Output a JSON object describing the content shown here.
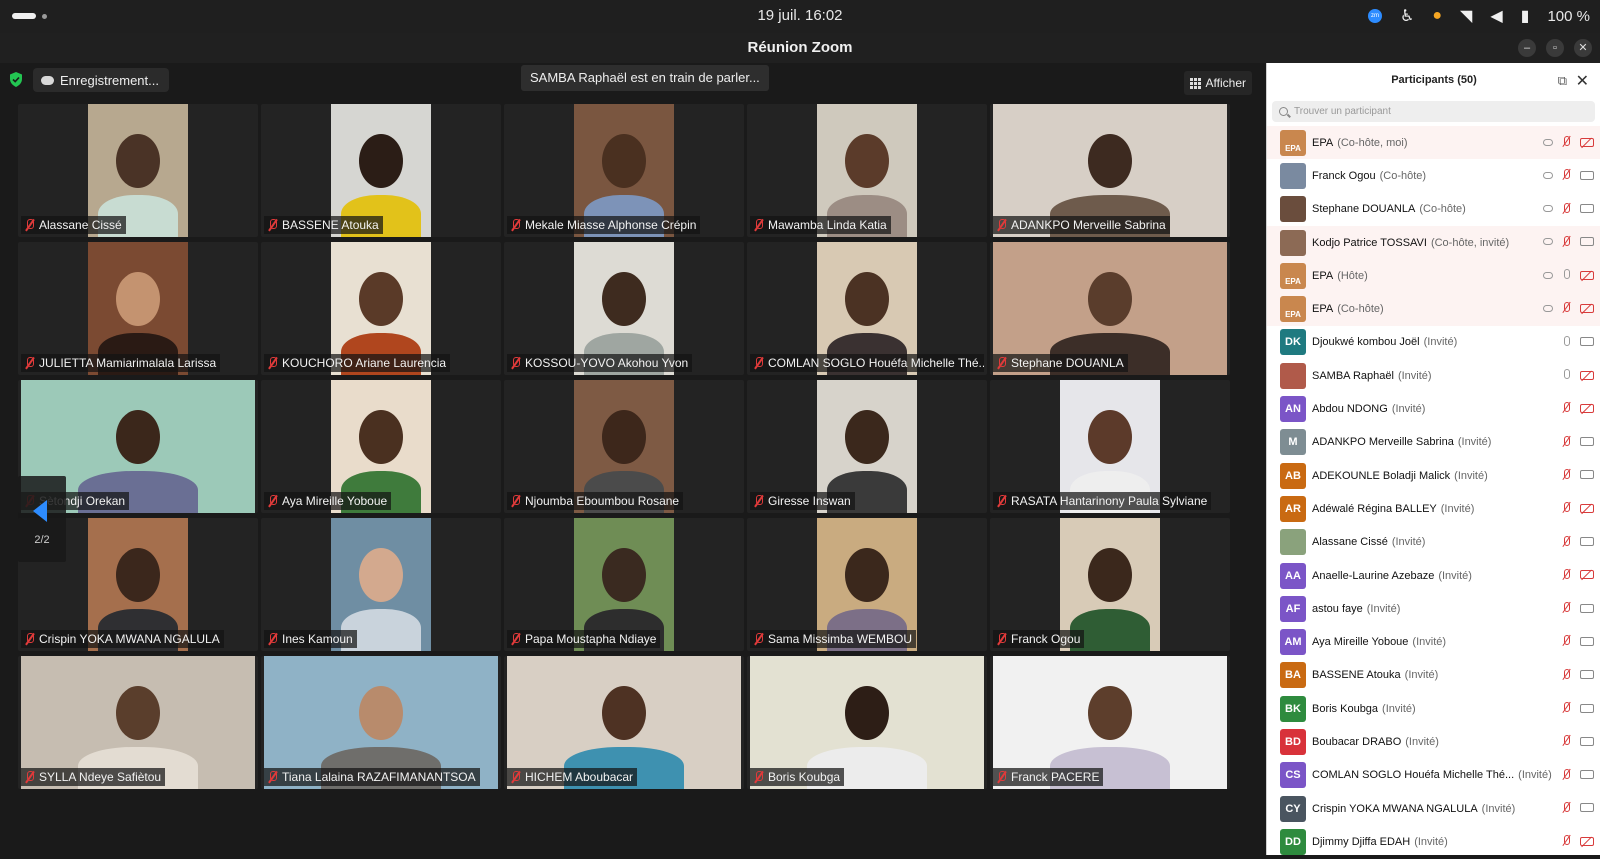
{
  "system": {
    "clock": "19 juil.   16:02",
    "zoom_badge": "zm",
    "battery": "100 %"
  },
  "window": {
    "title": "Réunion Zoom"
  },
  "meeting": {
    "recording_label": "Enregistrement...",
    "speaking_banner": "SAMBA Raphaël est en train de parler...",
    "view_label": "Afficher",
    "page_indicator": "2/2"
  },
  "tiles": [
    {
      "name": "Alassane Cissé",
      "bg": "#b7a88f",
      "skin": "#4a3326",
      "shirt": "#c8dcd2"
    },
    {
      "name": "BASSENE Atouka",
      "bg": "#d6d6d2",
      "skin": "#2b1d16",
      "shirt": "#e2c21a"
    },
    {
      "name": "Mekale Miasse Alphonse Crépin",
      "bg": "#7a5640",
      "skin": "#4a3020",
      "shirt": "#7d93b8"
    },
    {
      "name": "Mawamba Linda Katia",
      "bg": "#cfc9bd",
      "skin": "#5b3b2a",
      "shirt": "#9c8d84"
    },
    {
      "name": "ADANKPO Merveille Sabrina",
      "bg": "#d7cfc6",
      "skin": "#3d2a20",
      "shirt": "#6e5b4c"
    },
    {
      "name": "JULIETTA Mamiarimalala Larissa",
      "bg": "#7b4a32",
      "skin": "#c49370",
      "shirt": "#2a1a14"
    },
    {
      "name": "KOUCHORO Ariane Laurencia",
      "bg": "#e8e0d2",
      "skin": "#5a3a28",
      "shirt": "#b0461e"
    },
    {
      "name": "KOSSOU-YOVO Akohou Yvon",
      "bg": "#dddbd4",
      "skin": "#3e2b1f",
      "shirt": "#9fa6a1"
    },
    {
      "name": "COMLAN SOGLO Houéfa Michelle Thé...",
      "bg": "#d8c9b3",
      "skin": "#4b3223",
      "shirt": "#3a3131"
    },
    {
      "name": "Stephane DOUANLA",
      "bg": "#c3a089",
      "skin": "#5a3d2c",
      "shirt": "#3c2e28"
    },
    {
      "name": "Sètondji Orekan",
      "bg": "#9cc9b8",
      "skin": "#3b271b",
      "shirt": "#6a6f94"
    },
    {
      "name": "Aya Mireille Yoboue",
      "bg": "#e9dccb",
      "skin": "#4a3020",
      "shirt": "#3f7b3c"
    },
    {
      "name": "Njoumba Eboumbou Rosane",
      "bg": "#7e5a44",
      "skin": "#3d271b",
      "shirt": "#4b4b4b"
    },
    {
      "name": "Giresse Inswan",
      "bg": "#d7d3cb",
      "skin": "#3b281c",
      "shirt": "#3a3a3a"
    },
    {
      "name": "RASATA Hantarinony Paula Sylviane",
      "bg": "#e6e6ea",
      "skin": "#5c3a2a",
      "shirt": "#eeeeee"
    },
    {
      "name": "Crispin YOKA MWANA NGALULA",
      "bg": "#a56f4d",
      "skin": "#3b271c",
      "shirt": "#2f2f32"
    },
    {
      "name": "Ines Kamoun",
      "bg": "#6f8ea3",
      "skin": "#d3a98e",
      "shirt": "#c9d3dc"
    },
    {
      "name": "Papa Moustapha Ndiaye",
      "bg": "#6f8d55",
      "skin": "#3a2a20",
      "shirt": "#2d2d2d"
    },
    {
      "name": "Sama Missimba WEMBOU",
      "bg": "#c9ab80",
      "skin": "#3b281c",
      "shirt": "#7c6f87"
    },
    {
      "name": "Franck Ogou",
      "bg": "#d8cbb7",
      "skin": "#3b281c",
      "shirt": "#2f5d34"
    },
    {
      "name": "SYLLA Ndeye Safiètou",
      "bg": "#c6bdb1",
      "skin": "#5a3e2c",
      "shirt": "#e3dcd2"
    },
    {
      "name": "Tiana Lalaina RAZAFIMANANTSOA",
      "bg": "#8fb2c6",
      "skin": "#b88b6c",
      "shirt": "#6f6e6b"
    },
    {
      "name": "HICHEM Aboubacar",
      "bg": "#d8cfc4",
      "skin": "#4e3223",
      "shirt": "#3e91b0"
    },
    {
      "name": "Boris Koubga",
      "bg": "#e3e1d2",
      "skin": "#2d1e16",
      "shirt": "#ececec"
    },
    {
      "name": "Franck PACERE",
      "bg": "#f1f1f1",
      "skin": "#5d3e2c",
      "shirt": "#c7c0d3"
    }
  ],
  "participants_panel": {
    "title": "Participants (50)",
    "search_placeholder": "Trouver un participant",
    "list": [
      {
        "initials": "EPA",
        "name": "EPA",
        "role": "(Co-hôte, moi)",
        "color": "#c9874e",
        "host": true,
        "cloud": true,
        "mic_on": false,
        "cam_off": true
      },
      {
        "initials": "",
        "name": "Franck Ogou",
        "role": "(Co-hôte)",
        "color": "#7a8aa0",
        "host": false,
        "cloud": true,
        "mic_on": false,
        "cam_off": false
      },
      {
        "initials": "",
        "name": "Stephane DOUANLA",
        "role": "(Co-hôte)",
        "color": "#6a4d3d",
        "host": false,
        "cloud": true,
        "mic_on": false,
        "cam_off": false
      },
      {
        "initials": "",
        "name": "Kodjo Patrice TOSSAVI",
        "role": "(Co-hôte, invité)",
        "color": "#8c6a55",
        "host": true,
        "cloud": true,
        "mic_on": false,
        "cam_off": false
      },
      {
        "initials": "EPA",
        "name": "EPA",
        "role": "(Hôte)",
        "color": "#c9874e",
        "host": true,
        "cloud": true,
        "mic_on": true,
        "cam_off": true
      },
      {
        "initials": "EPA",
        "name": "EPA",
        "role": "(Co-hôte)",
        "color": "#c9874e",
        "host": true,
        "cloud": true,
        "mic_on": false,
        "cam_off": true
      },
      {
        "initials": "DK",
        "name": "Djoukwé kombou Joël",
        "role": "(Invité)",
        "color": "#1f7a80",
        "host": false,
        "cloud": false,
        "mic_on": true,
        "cam_off": false
      },
      {
        "initials": "",
        "name": "SAMBA Raphaël",
        "role": "(Invité)",
        "color": "#b05a4a",
        "host": false,
        "cloud": false,
        "mic_on": true,
        "cam_off": true
      },
      {
        "initials": "AN",
        "name": "Abdou NDONG",
        "role": "(Invité)",
        "color": "#7b55c7",
        "host": false,
        "cloud": false,
        "mic_on": false,
        "cam_off": true
      },
      {
        "initials": "M",
        "name": "ADANKPO Merveille Sabrina",
        "role": "(Invité)",
        "color": "#7e8d93",
        "host": false,
        "cloud": false,
        "mic_on": false,
        "cam_off": false
      },
      {
        "initials": "AB",
        "name": "ADEKOUNLE Boladji Malick",
        "role": "(Invité)",
        "color": "#c96a12",
        "host": false,
        "cloud": false,
        "mic_on": false,
        "cam_off": false
      },
      {
        "initials": "AR",
        "name": "Adéwalé Régina BALLEY",
        "role": "(Invité)",
        "color": "#c96a12",
        "host": false,
        "cloud": false,
        "mic_on": false,
        "cam_off": true
      },
      {
        "initials": "",
        "name": "Alassane Cissé",
        "role": "(Invité)",
        "color": "#8aa27c",
        "host": false,
        "cloud": false,
        "mic_on": false,
        "cam_off": false
      },
      {
        "initials": "AA",
        "name": "Anaelle-Laurine Azebaze",
        "role": "(Invité)",
        "color": "#7b55c7",
        "host": false,
        "cloud": false,
        "mic_on": false,
        "cam_off": true
      },
      {
        "initials": "AF",
        "name": "astou faye",
        "role": "(Invité)",
        "color": "#7b55c7",
        "host": false,
        "cloud": false,
        "mic_on": false,
        "cam_off": false
      },
      {
        "initials": "AM",
        "name": "Aya Mireille Yoboue",
        "role": "(Invité)",
        "color": "#7b55c7",
        "host": false,
        "cloud": false,
        "mic_on": false,
        "cam_off": false
      },
      {
        "initials": "BA",
        "name": "BASSENE Atouka",
        "role": "(Invité)",
        "color": "#c96a12",
        "host": false,
        "cloud": false,
        "mic_on": false,
        "cam_off": false
      },
      {
        "initials": "BK",
        "name": "Boris Koubga",
        "role": "(Invité)",
        "color": "#2e8b3e",
        "host": false,
        "cloud": false,
        "mic_on": false,
        "cam_off": false
      },
      {
        "initials": "BD",
        "name": "Boubacar DRABO",
        "role": "(Invité)",
        "color": "#d8323a",
        "host": false,
        "cloud": false,
        "mic_on": false,
        "cam_off": false
      },
      {
        "initials": "CS",
        "name": "COMLAN SOGLO Houéfa Michelle Thé...",
        "role": "(Invité)",
        "color": "#7b55c7",
        "host": false,
        "cloud": false,
        "mic_on": false,
        "cam_off": false
      },
      {
        "initials": "CY",
        "name": "Crispin YOKA MWANA NGALULA",
        "role": "(Invité)",
        "color": "#4a5560",
        "host": false,
        "cloud": false,
        "mic_on": false,
        "cam_off": false
      },
      {
        "initials": "DD",
        "name": "Djimmy Djiffa EDAH",
        "role": "(Invité)",
        "color": "#2e8b3e",
        "host": false,
        "cloud": false,
        "mic_on": false,
        "cam_off": true
      }
    ]
  }
}
